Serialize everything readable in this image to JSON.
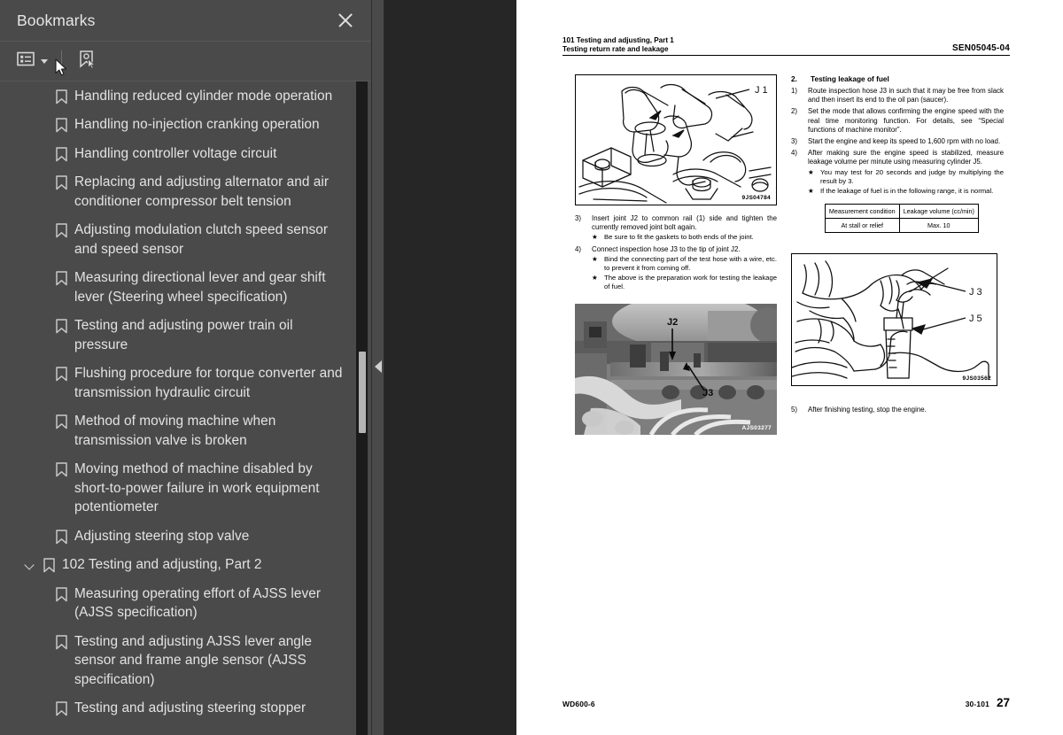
{
  "sidebar": {
    "title": "Bookmarks",
    "close_icon": "close-icon",
    "toolbar": {
      "list_options_icon": "list-options-icon",
      "caret_icon": "chevron-down-icon",
      "new_bookmark_icon": "new-bookmark-icon"
    },
    "bookmarks": [
      {
        "label": "Handling reduced cylinder mode operation",
        "level": 1,
        "expandable": false
      },
      {
        "label": "Handling no-injection cranking operation",
        "level": 1,
        "expandable": false
      },
      {
        "label": "Handling controller voltage circuit",
        "level": 1,
        "expandable": false
      },
      {
        "label": "Replacing and adjusting alternator and air conditioner compressor belt tension",
        "level": 1,
        "expandable": false
      },
      {
        "label": "Adjusting modulation clutch speed sensor and speed sensor",
        "level": 1,
        "expandable": false
      },
      {
        "label": "Measuring directional lever and gear shift lever (Steering wheel specification)",
        "level": 1,
        "expandable": false
      },
      {
        "label": "Testing and adjusting power train oil pressure",
        "level": 1,
        "expandable": false
      },
      {
        "label": "Flushing procedure for torque converter and transmission hydraulic circuit",
        "level": 1,
        "expandable": false
      },
      {
        "label": "Method of moving machine when transmission valve is broken",
        "level": 1,
        "expandable": false
      },
      {
        "label": "Moving method of machine disabled by short-to-power failure in work equipment potentiometer",
        "level": 1,
        "expandable": false
      },
      {
        "label": "Adjusting steering stop valve",
        "level": 1,
        "expandable": false
      },
      {
        "label": "102 Testing and adjusting, Part 2",
        "level": 0,
        "expandable": true
      },
      {
        "label": "Measuring operating effort of AJSS lever (AJSS specification)",
        "level": 1,
        "expandable": false
      },
      {
        "label": "Testing and adjusting AJSS lever angle sensor and frame angle sensor (AJSS specification)",
        "level": 1,
        "expandable": false
      },
      {
        "label": "Testing and adjusting steering stopper",
        "level": 1,
        "expandable": false
      }
    ]
  },
  "splitter": {
    "collapse_icon": "collapse-left-icon"
  },
  "document": {
    "header": {
      "line1": "101 Testing and adjusting, Part 1",
      "line2": "Testing return rate and leakage",
      "doc_number": "SEN05045-04"
    },
    "figure1": {
      "code": "9JS04784",
      "callout": "J 1",
      "type": "line-drawing"
    },
    "figure2": {
      "code": "AJS03277",
      "callout1": "J2",
      "callout2": "J3",
      "type": "photograph"
    },
    "figure3": {
      "code": "9JS03562",
      "callout1": "J 3",
      "callout2": "J 5",
      "type": "line-drawing"
    },
    "left_column": {
      "steps": [
        {
          "num": "3)",
          "text": "Insert joint J2 to common rail (1) side and tighten the currently removed joint bolt again.",
          "stars": [
            "Be sure to fit the gaskets to both ends of the joint."
          ]
        },
        {
          "num": "4)",
          "text": "Connect inspection hose J3 to the tip of joint J2.",
          "stars": [
            "Bind the connecting part of the test hose with a wire, etc. to prevent it from coming off.",
            "The above is the preparation work for testing the leakage of fuel."
          ]
        }
      ]
    },
    "right_column": {
      "section_num": "2.",
      "section_title": "Testing leakage of fuel",
      "steps": [
        {
          "num": "1)",
          "text": "Route inspection hose J3 in such that it may be free from slack and then insert its end to the oil pan (saucer).",
          "stars": []
        },
        {
          "num": "2)",
          "text": "Set the mode that allows confirming the engine speed with the real time monitoring function. For details, see “Special functions of machine monitor”.",
          "stars": []
        },
        {
          "num": "3)",
          "text": "Start the engine and keep its speed to 1,600 rpm with no load.",
          "stars": []
        },
        {
          "num": "4)",
          "text": "After making sure the engine speed is stabilized, measure leakage volume per minute using measuring cylinder J5.",
          "stars": [
            "You may test for 20 seconds and judge by multiplying the result by 3.",
            "If the leakage of fuel is in the following range, it is normal."
          ]
        }
      ],
      "table": {
        "headers": [
          "Measurement condition",
          "Leakage volume (cc/min)"
        ],
        "rows": [
          [
            "At stall or relief",
            "Max. 10"
          ]
        ]
      },
      "final_step": {
        "num": "5)",
        "text": "After finishing testing, stop the engine."
      }
    },
    "footer": {
      "model": "WD600-6",
      "section": "30-101",
      "page": "27"
    }
  },
  "colors": {
    "sidebar_bg": "#4a4a4a",
    "viewer_bg": "#262626",
    "page_bg": "#ffffff",
    "text": "#e3e3e3",
    "scrollbar_track": "#1b1b1b",
    "scrollbar_thumb": "#b4b4b4"
  }
}
